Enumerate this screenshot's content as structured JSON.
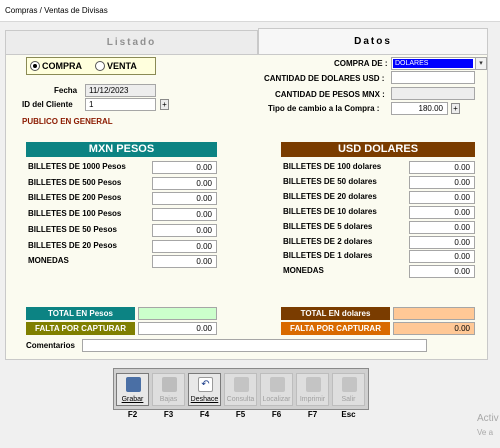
{
  "window": {
    "title": "Compras / Ventas de Divisas"
  },
  "tabs": [
    {
      "label": "Listado",
      "active": false
    },
    {
      "label": "Datos",
      "active": true
    }
  ],
  "operation": {
    "options": [
      "COMPRA",
      "VENTA"
    ],
    "selected": "COMPRA"
  },
  "form": {
    "fecha_label": "Fecha",
    "fecha_value": "11/12/2023",
    "cliente_label": "ID del Cliente",
    "cliente_value": "1",
    "publico_label": "PUBLICO EN GENERAL",
    "compra_de_label": "COMPRA DE :",
    "compra_de_value": "DOLARES",
    "cantidad_usd_label": "CANTIDAD DE DOLARES USD :",
    "cantidad_usd_value": "",
    "cantidad_mnx_label": "CANTIDAD DE PESOS MNX :",
    "cantidad_mnx_value": "",
    "tipo_cambio_label": "Tipo de cambio a la Compra :",
    "tipo_cambio_value": "180.00",
    "plus": "+"
  },
  "mxn": {
    "header": "MXN PESOS",
    "rows": [
      {
        "label": "BILLETES DE 1000 Pesos",
        "value": "0.00"
      },
      {
        "label": "BILLETES DE  500 Pesos",
        "value": "0.00"
      },
      {
        "label": "BILLETES DE  200 Pesos",
        "value": "0.00"
      },
      {
        "label": "BILLETES DE  100 Pesos",
        "value": "0.00"
      },
      {
        "label": "BILLETES DE   50 Pesos",
        "value": "0.00"
      },
      {
        "label": "BILLETES DE   20 Pesos",
        "value": "0.00"
      },
      {
        "label": "MONEDAS",
        "value": "0.00"
      }
    ],
    "total_label": "TOTAL EN Pesos",
    "total_value": "",
    "falta_label": "FALTA POR CAPTURAR",
    "falta_value": "0.00"
  },
  "usd": {
    "header": "USD DOLARES",
    "rows": [
      {
        "label": "BILLETES DE  100 dolares",
        "value": "0.00"
      },
      {
        "label": "BILLETES DE   50 dolares",
        "value": "0.00"
      },
      {
        "label": "BILLETES DE   20 dolares",
        "value": "0.00"
      },
      {
        "label": "BILLETES DE   10 dolares",
        "value": "0.00"
      },
      {
        "label": "BILLETES DE    5 dolares",
        "value": "0.00"
      },
      {
        "label": "BILLETES DE    2 dolares",
        "value": "0.00"
      },
      {
        "label": "BILLETES DE    1 dolares",
        "value": "0.00"
      },
      {
        "label": "MONEDAS",
        "value": "0.00"
      }
    ],
    "total_label": "TOTAL EN dolares",
    "total_value": "",
    "falta_label": "FALTA POR CAPTURAR",
    "falta_value": "0.00"
  },
  "comentarios": {
    "label": "Comentarios",
    "value": ""
  },
  "toolbar": [
    {
      "name": "grabar",
      "label": "Grabar",
      "key": "F2",
      "enabled": true,
      "icon": "save-icon"
    },
    {
      "name": "bajas",
      "label": "Bajas",
      "key": "F3",
      "enabled": false,
      "icon": "delete-icon"
    },
    {
      "name": "deshacer",
      "label": "Deshace",
      "key": "F4",
      "enabled": true,
      "icon": "undo-icon"
    },
    {
      "name": "consulta",
      "label": "Consulta",
      "key": "F5",
      "enabled": false,
      "icon": "document-icon"
    },
    {
      "name": "localizar",
      "label": "Localizar",
      "key": "F6",
      "enabled": false,
      "icon": "search-icon"
    },
    {
      "name": "imprimir",
      "label": "Imprimir",
      "key": "F7",
      "enabled": false,
      "icon": "printer-icon"
    },
    {
      "name": "salir",
      "label": "Salir",
      "key": "Esc",
      "enabled": false,
      "icon": "exit-icon"
    }
  ],
  "os_overlay": {
    "line1": "Activ",
    "line2": "Ve a"
  },
  "colors": {
    "mxn_header": "#0c8383",
    "usd_header": "#7a3c00",
    "falta_mxn": "#7f7f00",
    "falta_usd": "#d96a00",
    "total_mxn_field": "#ccffcc",
    "total_usd_field": "#ffc896",
    "publico": "#8b1a00"
  }
}
